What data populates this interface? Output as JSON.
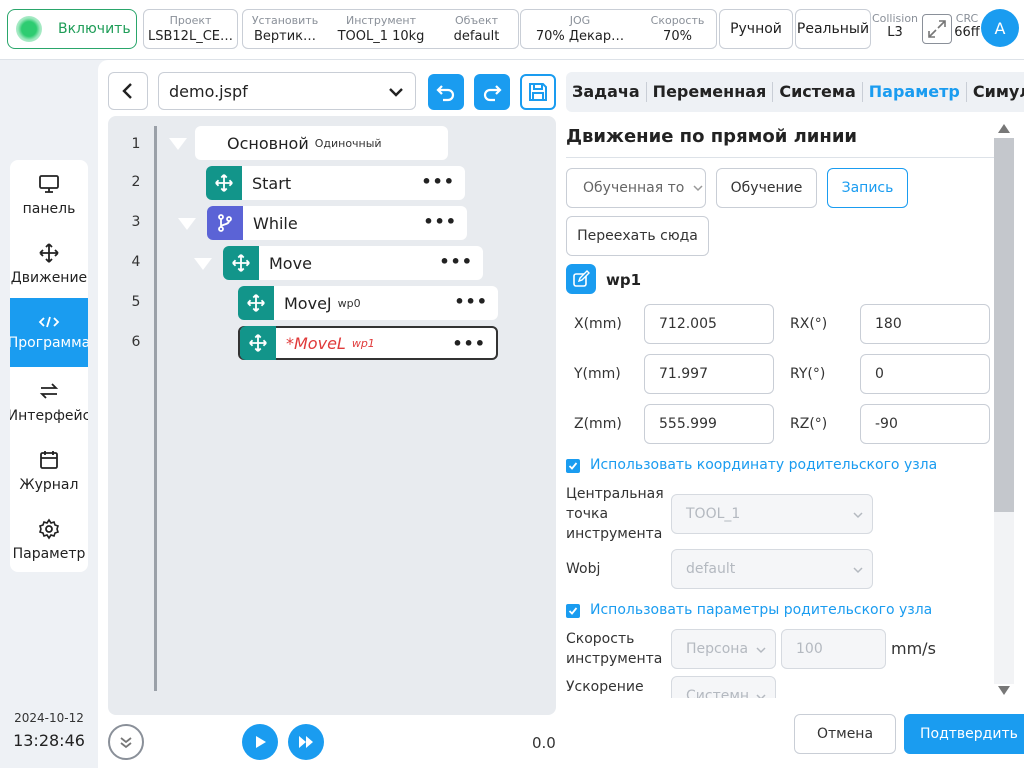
{
  "colors": {
    "accent": "#1a9cf0",
    "node_green": "#12958a",
    "node_purple": "#5b63d6",
    "power_green": "#2ecc71",
    "error_red": "#e03a3a"
  },
  "topbar": {
    "power_label": "Включить",
    "project": {
      "caption": "Проект",
      "value": "LSB12L_CE…"
    },
    "install": {
      "caption": "Установить",
      "value": "Вертик…"
    },
    "tool": {
      "caption": "Инструмент",
      "value": "TOOL_1  10kg"
    },
    "object": {
      "caption": "Объект",
      "value": "default"
    },
    "jog": {
      "caption": "JOG",
      "value": "70%  Декар…"
    },
    "speed": {
      "caption": "Скорость",
      "value": "70%"
    },
    "manual_label": "Ручной",
    "real_label": "Реальный",
    "collision": {
      "caption": "Collision",
      "value": "L3"
    },
    "crc": {
      "caption": "CRC",
      "value": "66ff"
    },
    "avatar_letter": "A"
  },
  "leftnav": {
    "items": [
      {
        "label": "панель",
        "icon": "monitor-icon"
      },
      {
        "label": "Движение",
        "icon": "move-icon"
      },
      {
        "label": "Программа",
        "icon": "code-icon",
        "active": true
      },
      {
        "label": "Интерфейс",
        "icon": "swap-icon"
      },
      {
        "label": "Журнал",
        "icon": "calendar-icon"
      },
      {
        "label": "Параметр",
        "icon": "gear-icon"
      }
    ],
    "date": "2024-10-12",
    "time": "13:28:46"
  },
  "program": {
    "file_name": "demo.jspf",
    "line_numbers": [
      "1",
      "2",
      "3",
      "4",
      "5",
      "6"
    ],
    "nodes": [
      {
        "label": "Основной",
        "sub": "Одиночный"
      },
      {
        "label": "Start",
        "icon": "move-icon"
      },
      {
        "label": "While",
        "icon": "branch-icon"
      },
      {
        "label": "Move",
        "icon": "move-icon"
      },
      {
        "label": "MoveJ",
        "sub": "wp0",
        "icon": "move-icon"
      },
      {
        "label": "*MoveL",
        "sub": "wp1",
        "icon": "move-icon",
        "selected": true
      }
    ],
    "speed_value": "0.0"
  },
  "tabs": [
    "Задача",
    "Переменная",
    "Система",
    "Параметр",
    "Симуляция"
  ],
  "active_tab": "Параметр",
  "param": {
    "title": "Движение по прямой линии",
    "taught_select": "Обученная то",
    "teach_button": "Обучение",
    "record_button": "Запись",
    "move_here_button": "Переехать сюда",
    "waypoint_name": "wp1",
    "coords": {
      "x_label": "X(mm)",
      "x_value": "712.005",
      "y_label": "Y(mm)",
      "y_value": "71.997",
      "z_label": "Z(mm)",
      "z_value": "555.999",
      "rx_label": "RX(°)",
      "rx_value": "180",
      "ry_label": "RY(°)",
      "ry_value": "0",
      "rz_label": "RZ(°)",
      "rz_value": "-90"
    },
    "use_parent_coord_label": "Использовать координату родительского узла",
    "use_parent_coord_checked": true,
    "tcp_label_1": "Центральная",
    "tcp_label_2": "точка",
    "tcp_label_3": "инструмента",
    "tcp_value": "TOOL_1",
    "wobj_label": "Wobj",
    "wobj_value": "default",
    "use_parent_params_label": "Использовать параметры родительского узла",
    "use_parent_params_checked": true,
    "tool_speed_label_1": "Скорость",
    "tool_speed_label_2": "инструмента",
    "tool_speed_mode": "Персона",
    "tool_speed_value": "100",
    "tool_speed_unit": "mm/s",
    "accel_label": "Ускорение",
    "accel_mode": "Системн"
  },
  "footer": {
    "cancel_label": "Отмена",
    "confirm_label": "Подтвердить"
  }
}
